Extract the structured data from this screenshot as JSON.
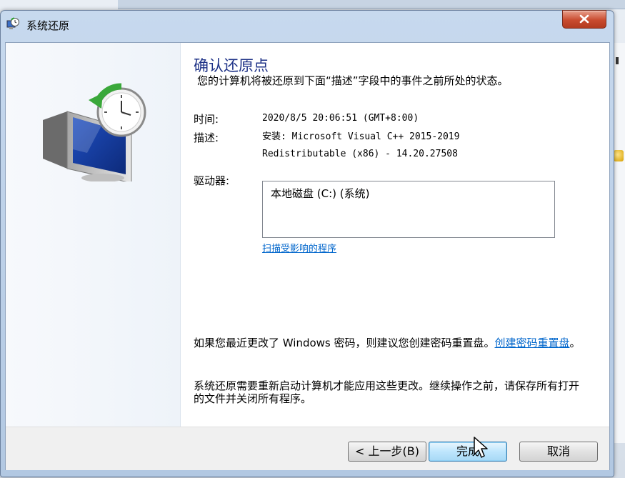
{
  "window": {
    "title": "系统还原",
    "close_glyph": "X",
    "accent": "#1e3287",
    "link_color": "#0066cc"
  },
  "page": {
    "heading": "确认还原点",
    "subtext": "您的计算机将被还原到下面“描述”字段中的事件之前所处的状态。",
    "time_label": "时间:",
    "time_value": "2020/8/5 20:06:51 (GMT+8:00)",
    "desc_label": "描述:",
    "desc_line1": "安装: Microsoft Visual C++ 2015-2019",
    "desc_line2": "Redistributable (x86) - 14.20.27508",
    "drives_label": "驱动器:",
    "drives": [
      "本地磁盘 (C:) (系统)"
    ],
    "scan_link": "扫描受影响的程序",
    "note1_text": "如果您最近更改了 Windows 密码，则建议您创建密码重置盘。",
    "note1_link": "创建密码重置盘",
    "note1_end": "。",
    "note2_text": "系统还原需要重新启动计算机才能应用这些更改。继续操作之前，请保存所有打开的文件并关闭所有程序。"
  },
  "buttons": {
    "back": "< 上一步(B)",
    "finish": "完成",
    "cancel": "取消"
  },
  "icons": {
    "title": "system-restore-icon",
    "illustration": "monitor-clock-restore-icon",
    "cursor": "mouse-pointer-icon"
  }
}
